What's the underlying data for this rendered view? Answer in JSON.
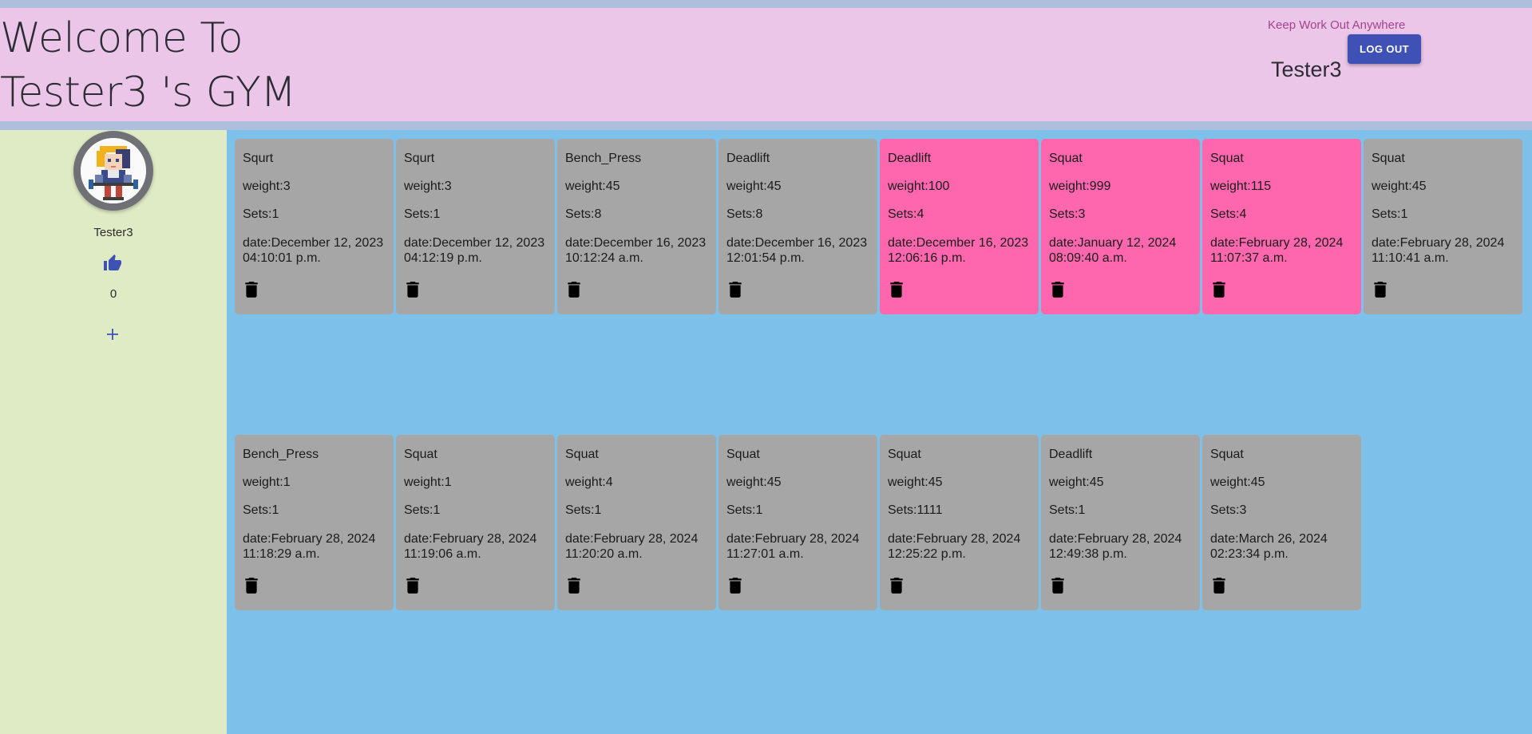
{
  "header": {
    "title_line1": "Welcome To",
    "title_line2": "Tester3 's GYM",
    "tagline": "Keep Work Out Anywhere",
    "logout_label": "LOG OUT",
    "username": "Tester3"
  },
  "sidebar": {
    "username": "Tester3",
    "like_count": "0",
    "icons": [
      "avatar",
      "thumb-up-icon",
      "add-icon"
    ]
  },
  "colors": {
    "header_bg": "#ecc6e8",
    "sidebar_bg": "#deebc4",
    "main_bg": "#7dc0e9",
    "card_bg": "#a6a6a6",
    "card_highlight_bg": "#fe67ae",
    "button_bg": "#3f51b5"
  },
  "workouts": [
    {
      "exercise": "Squrt",
      "weight": "weight:3",
      "sets": "Sets:1",
      "date_line1": "date:December 12, 2023",
      "date_line2": "04:10:01 p.m.",
      "highlight": false
    },
    {
      "exercise": "Squrt",
      "weight": "weight:3",
      "sets": "Sets:1",
      "date_line1": "date:December 12, 2023",
      "date_line2": "04:12:19 p.m.",
      "highlight": false
    },
    {
      "exercise": "Bench_Press",
      "weight": "weight:45",
      "sets": "Sets:8",
      "date_line1": "date:December 16, 2023",
      "date_line2": "10:12:24 a.m.",
      "highlight": false
    },
    {
      "exercise": "Deadlift",
      "weight": "weight:45",
      "sets": "Sets:8",
      "date_line1": "date:December 16, 2023",
      "date_line2": "12:01:54 p.m.",
      "highlight": false
    },
    {
      "exercise": "Deadlift",
      "weight": "weight:100",
      "sets": "Sets:4",
      "date_line1": "date:December 16, 2023",
      "date_line2": "12:06:16 p.m.",
      "highlight": true
    },
    {
      "exercise": "Squat",
      "weight": "weight:999",
      "sets": "Sets:3",
      "date_line1": "date:January 12, 2024",
      "date_line2": "08:09:40 a.m.",
      "highlight": true
    },
    {
      "exercise": "Squat",
      "weight": "weight:115",
      "sets": "Sets:4",
      "date_line1": "date:February 28, 2024",
      "date_line2": "11:07:37 a.m.",
      "highlight": true
    },
    {
      "exercise": "Squat",
      "weight": "weight:45",
      "sets": "Sets:1",
      "date_line1": "date:February 28, 2024",
      "date_line2": "11:10:41 a.m.",
      "highlight": false
    },
    {
      "exercise": "Bench_Press",
      "weight": "weight:1",
      "sets": "Sets:1",
      "date_line1": "date:February 28, 2024",
      "date_line2": "11:18:29 a.m.",
      "highlight": false
    },
    {
      "exercise": "Squat",
      "weight": "weight:1",
      "sets": "Sets:1",
      "date_line1": "date:February 28, 2024",
      "date_line2": "11:19:06 a.m.",
      "highlight": false
    },
    {
      "exercise": "Squat",
      "weight": "weight:4",
      "sets": "Sets:1",
      "date_line1": "date:February 28, 2024",
      "date_line2": "11:20:20 a.m.",
      "highlight": false
    },
    {
      "exercise": "Squat",
      "weight": "weight:45",
      "sets": "Sets:1",
      "date_line1": "date:February 28, 2024",
      "date_line2": "11:27:01 a.m.",
      "highlight": false
    },
    {
      "exercise": "Squat",
      "weight": "weight:45",
      "sets": "Sets:1111",
      "date_line1": "date:February 28, 2024",
      "date_line2": "12:25:22 p.m.",
      "highlight": false
    },
    {
      "exercise": "Deadlift",
      "weight": "weight:45",
      "sets": "Sets:1",
      "date_line1": "date:February 28, 2024",
      "date_line2": "12:49:38 p.m.",
      "highlight": false
    },
    {
      "exercise": "Squat",
      "weight": "weight:45",
      "sets": "Sets:3",
      "date_line1": "date:March 26, 2024",
      "date_line2": "02:23:34 p.m.",
      "highlight": false
    }
  ]
}
